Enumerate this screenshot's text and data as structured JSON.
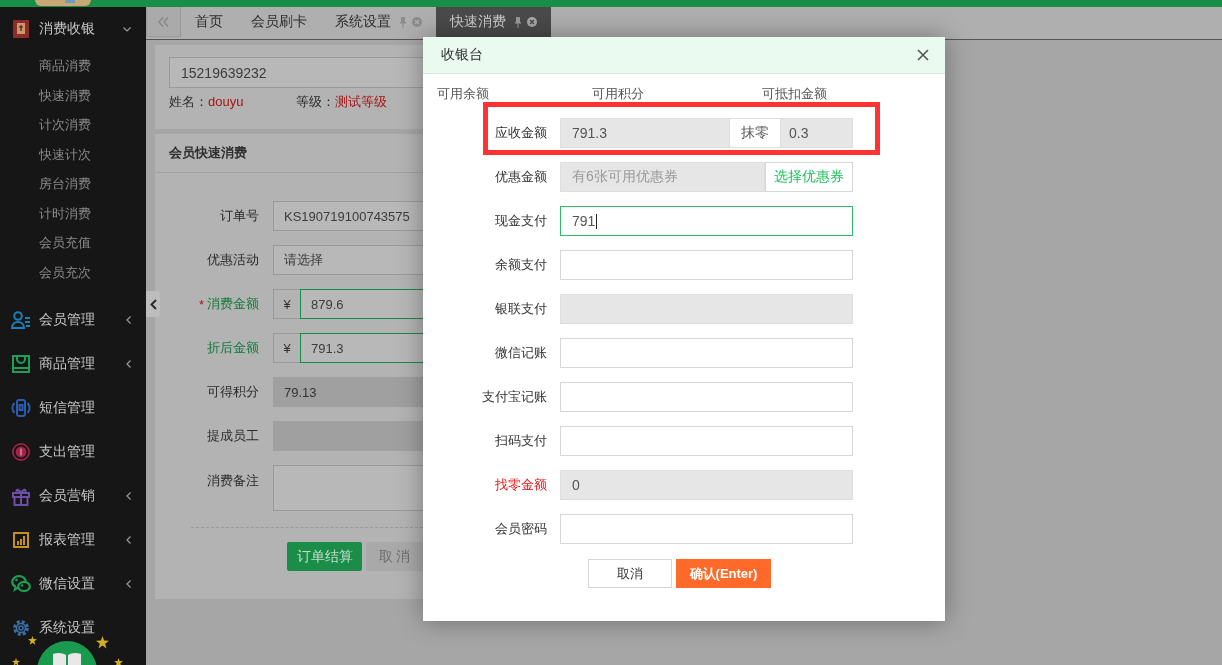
{
  "sidebar": {
    "items": [
      {
        "label": "消费收银",
        "kind": "menu",
        "expanded": true,
        "color": "#8e2b2b",
        "children": [
          {
            "label": "商品消费"
          },
          {
            "label": "快速消费"
          },
          {
            "label": "计次消费"
          },
          {
            "label": "快速计次"
          },
          {
            "label": "房台消费"
          },
          {
            "label": "计时消费"
          },
          {
            "label": "会员充值"
          },
          {
            "label": "会员充次"
          }
        ]
      },
      {
        "label": "会员管理",
        "kind": "menu",
        "expanded": false,
        "color": "#1b7fb5"
      },
      {
        "label": "商品管理",
        "kind": "menu",
        "expanded": false,
        "color": "#1e9e5a"
      },
      {
        "label": "短信管理",
        "kind": "link",
        "color": "#2a5caa"
      },
      {
        "label": "支出管理",
        "kind": "link",
        "color": "#a3234a"
      },
      {
        "label": "会员营销",
        "kind": "menu",
        "expanded": false,
        "color": "#6b4fa8"
      },
      {
        "label": "报表管理",
        "kind": "menu",
        "expanded": false,
        "color": "#c4921e"
      },
      {
        "label": "微信设置",
        "kind": "menu",
        "expanded": false,
        "color": "#1f9d55"
      },
      {
        "label": "系统设置",
        "kind": "link",
        "color": "#3b6ea5"
      }
    ]
  },
  "tabs": [
    {
      "label": "首页",
      "selected": false,
      "closable": false
    },
    {
      "label": "会员刷卡",
      "selected": false,
      "closable": false
    },
    {
      "label": "系统设置",
      "selected": false,
      "closable": true
    },
    {
      "label": "快速消费",
      "selected": true,
      "closable": true
    }
  ],
  "member": {
    "phone": "15219639232",
    "name_label": "姓名：",
    "name": "douyu",
    "grade_label": "等级：",
    "grade": "测试等级"
  },
  "quick_consume": {
    "title": "会员快速消费",
    "fields": [
      {
        "label": "订单号",
        "kind": "text",
        "value": "KS190719100743575",
        "highlighted": false,
        "disabled": false
      },
      {
        "label": "优惠活动",
        "kind": "select",
        "value": "请选择",
        "highlighted": false,
        "disabled": false
      },
      {
        "label": "消费金额",
        "marker": "*",
        "kind": "currency",
        "prefix": "¥",
        "value": "879.6",
        "highlighted": true,
        "disabled": false
      },
      {
        "label": "折后金额",
        "kind": "currency",
        "prefix": "¥",
        "value": "791.3",
        "highlighted": true,
        "disabled": false
      },
      {
        "label": "可得积分",
        "kind": "text",
        "value": "79.13",
        "highlighted": false,
        "disabled": true
      },
      {
        "label": "提成员工",
        "kind": "text",
        "highlighted": false,
        "disabled": true
      },
      {
        "label": "消费备注",
        "kind": "textarea",
        "highlighted": false,
        "disabled": false
      }
    ],
    "buttons": [
      {
        "label": "订单结算",
        "kind": "primary"
      },
      {
        "label": "取 消",
        "kind": "secondary"
      }
    ]
  },
  "cashier": {
    "title": "收银台",
    "balance_labels": [
      "可用余额",
      "可用积分",
      "可抵扣金额"
    ],
    "fields": [
      {
        "label": "应收金额",
        "kind": "split",
        "value": "791.3",
        "addon": "抹零",
        "extra_value": "0.3",
        "disabled": true,
        "focused": false,
        "highlighted": false
      },
      {
        "label": "优惠金额",
        "kind": "coupon",
        "placeholder": "有6张可用优惠券",
        "button": "选择优惠券",
        "disabled": true,
        "focused": false,
        "highlighted": false
      },
      {
        "label": "现金支付",
        "kind": "input",
        "value": "791",
        "disabled": false,
        "focused": true,
        "highlighted": false
      },
      {
        "label": "余额支付",
        "kind": "input",
        "disabled": false,
        "focused": false,
        "highlighted": false
      },
      {
        "label": "银联支付",
        "kind": "input",
        "disabled": true,
        "focused": false,
        "highlighted": false
      },
      {
        "label": "微信记账",
        "kind": "input",
        "disabled": false,
        "focused": false,
        "highlighted": false
      },
      {
        "label": "支付宝记账",
        "kind": "input",
        "disabled": false,
        "focused": false,
        "highlighted": false
      },
      {
        "label": "扫码支付",
        "kind": "input",
        "disabled": false,
        "focused": false,
        "highlighted": false
      },
      {
        "label": "找零金额",
        "kind": "input",
        "value": "0",
        "disabled": true,
        "focused": false,
        "highlighted": true
      },
      {
        "label": "会员密码",
        "kind": "input",
        "disabled": false,
        "focused": false,
        "highlighted": false
      }
    ],
    "buttons": [
      {
        "label": "取消",
        "kind": "secondary"
      },
      {
        "label": "确认(Enter)",
        "kind": "primary"
      }
    ]
  }
}
